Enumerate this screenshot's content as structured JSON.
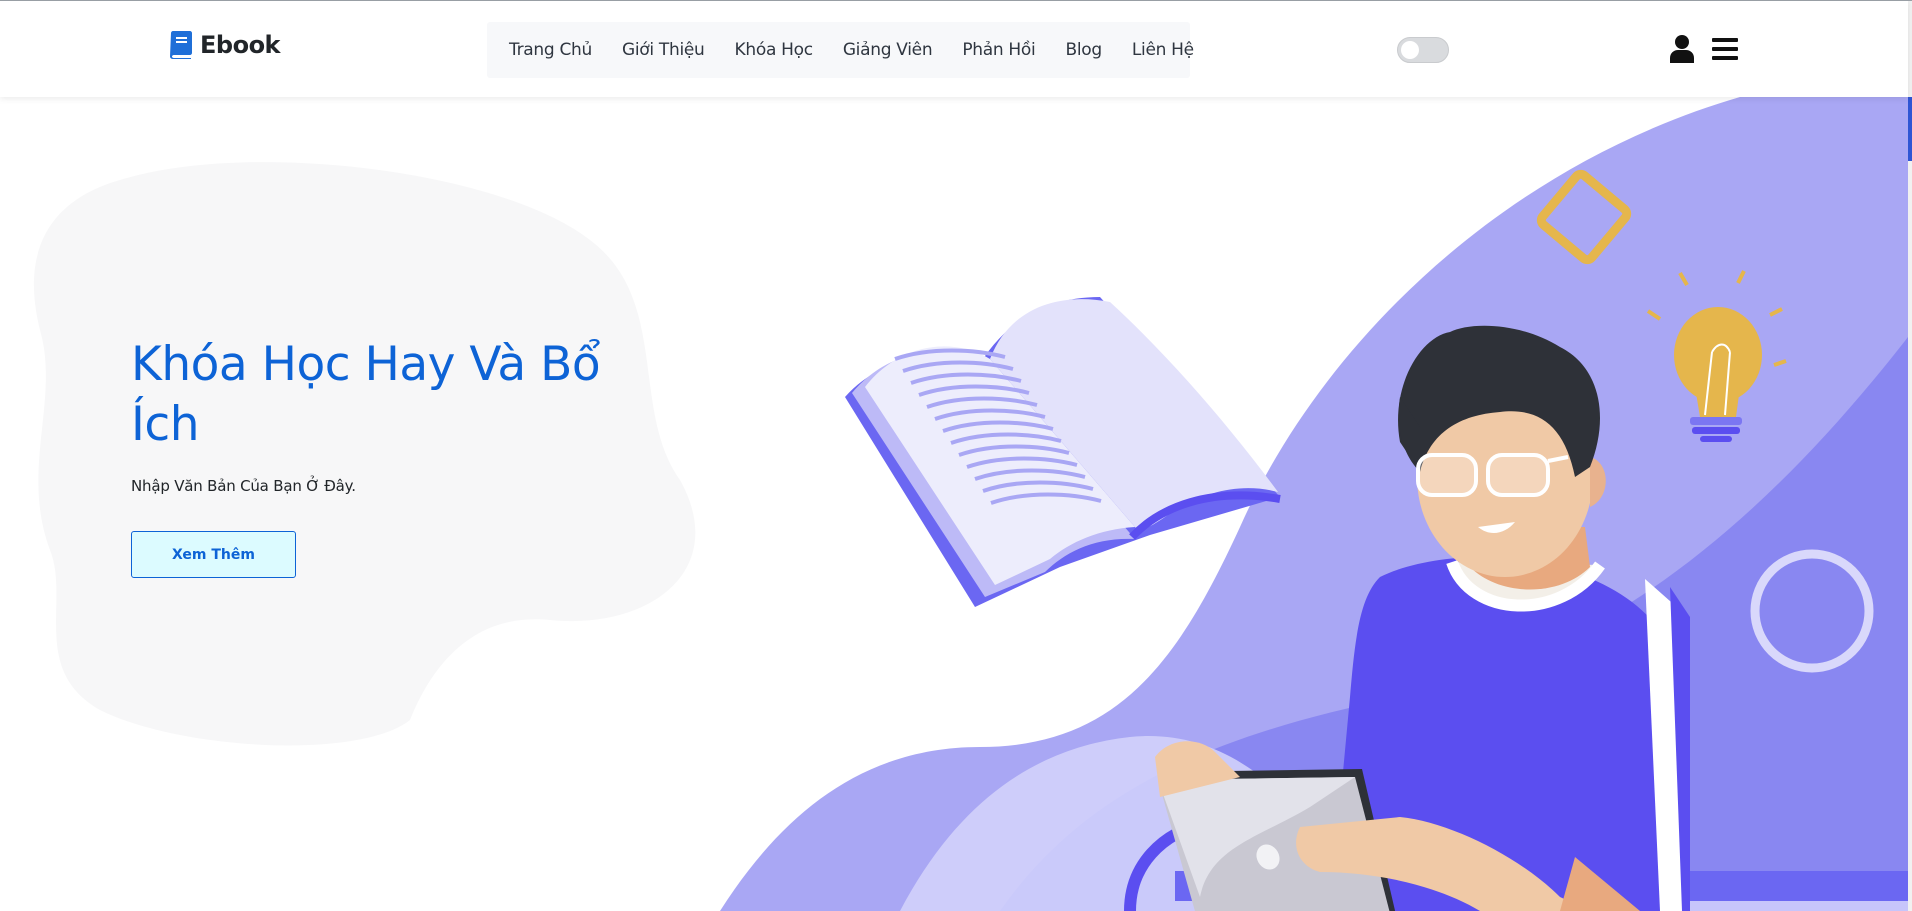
{
  "brand": {
    "name": "Ebook",
    "icon": "book-icon",
    "color": "#1f6fd8"
  },
  "nav": {
    "items": [
      {
        "label": "Trang Chủ"
      },
      {
        "label": "Giới Thiệu"
      },
      {
        "label": "Khóa Học"
      },
      {
        "label": "Giảng Viên"
      },
      {
        "label": "Phản Hồi"
      },
      {
        "label": "Blog"
      },
      {
        "label": "Liên Hệ"
      }
    ]
  },
  "header_icons": {
    "toggle": "theme-toggle",
    "user": "user-icon",
    "menu": "hamburger-menu-icon"
  },
  "hero": {
    "title": "Khóa Học Hay Và Bổ Ích",
    "subtitle": "Nhập Văn Bản Của Bạn Ở Đây.",
    "button_label": "Xem Thêm",
    "accent": "#0d63d6",
    "illustration": "student-with-tablet-book-lightbulb"
  },
  "colors": {
    "purple": "#5b4ef0",
    "lavender": "#a9a7f4",
    "gold": "#e5b64c"
  }
}
